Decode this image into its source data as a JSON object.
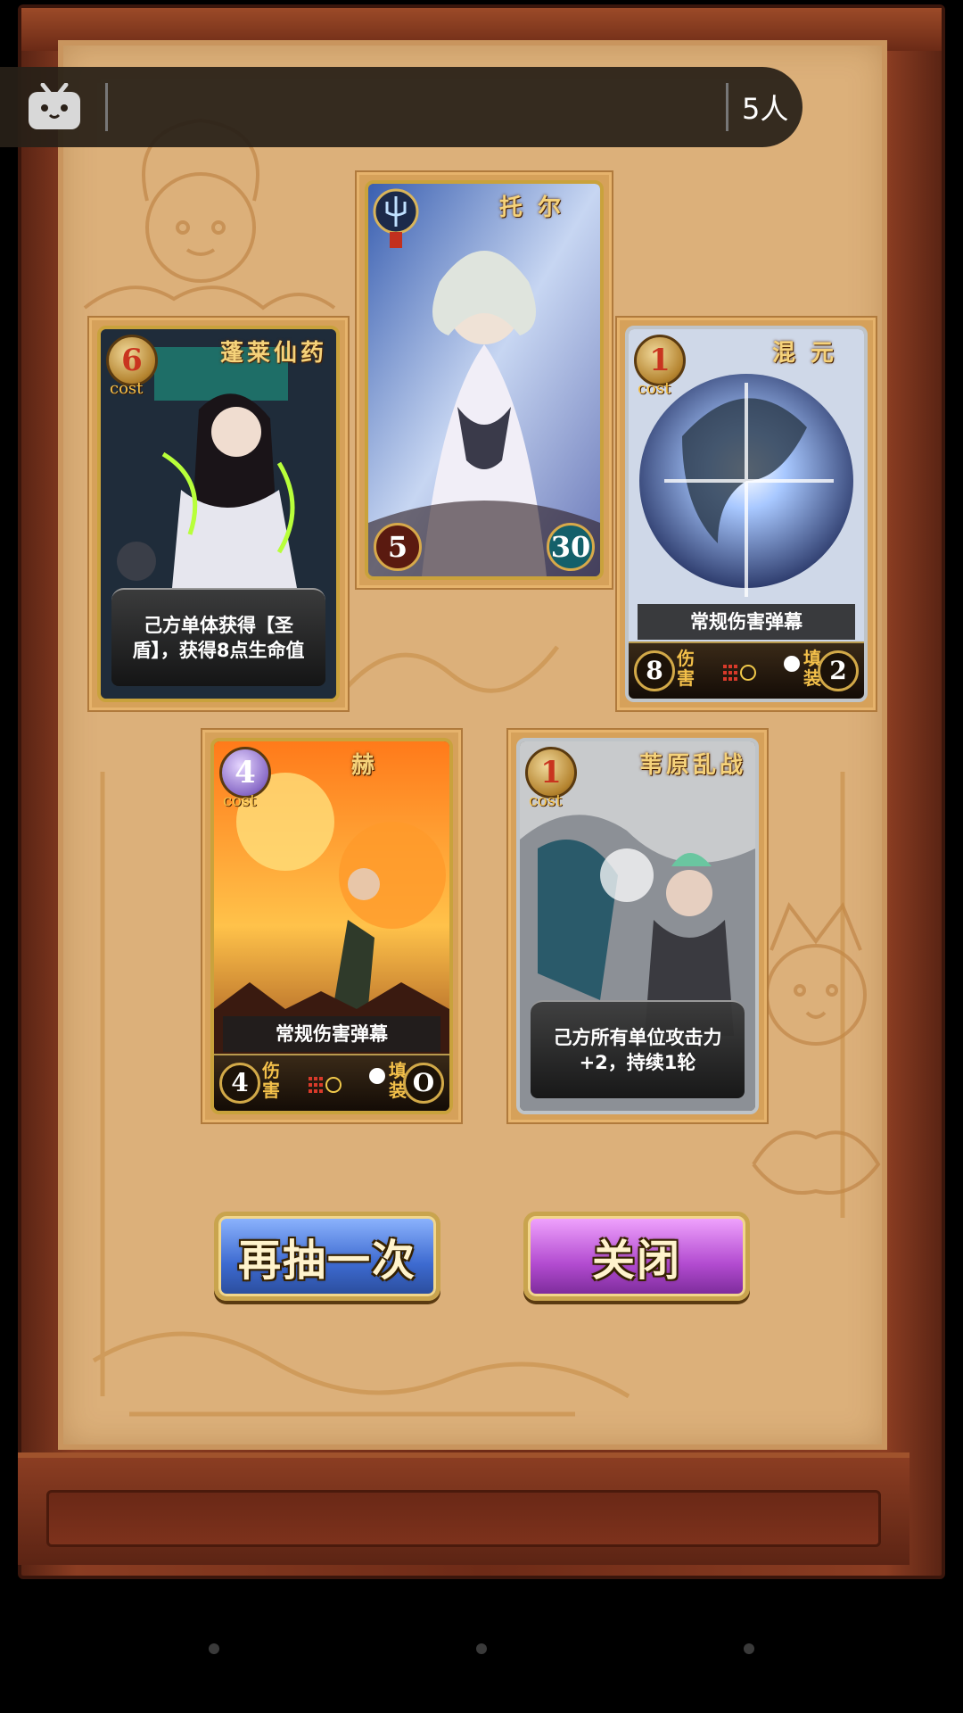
{
  "overlay": {
    "app_icon": "bilibili-tv-icon",
    "viewer_count": "5人"
  },
  "cards": {
    "top": {
      "name": "托 尔",
      "attack": "5",
      "hp": "30"
    },
    "left": {
      "name": "蓬莱仙药",
      "cost": "6",
      "cost_label": "cost",
      "description": "己方单体获得【圣盾】，获得8点生命值"
    },
    "right": {
      "name": "混 元",
      "cost": "1",
      "cost_label": "cost",
      "skill": "常规伤害弹幕",
      "damage": "8",
      "damage_label": "伤害",
      "reload_label": "填装",
      "reload": "2"
    },
    "bottom_left": {
      "name": "赫",
      "cost": "4",
      "cost_label": "cost",
      "skill": "常规伤害弹幕",
      "damage": "4",
      "damage_label": "伤害",
      "reload_label": "填装",
      "reload": "O"
    },
    "bottom_right": {
      "name": "苇原乱战",
      "cost": "1",
      "cost_label": "cost",
      "description": "己方所有单位攻击力+2，持续1轮"
    }
  },
  "buttons": {
    "redraw": "再抽一次",
    "close": "关闭"
  }
}
